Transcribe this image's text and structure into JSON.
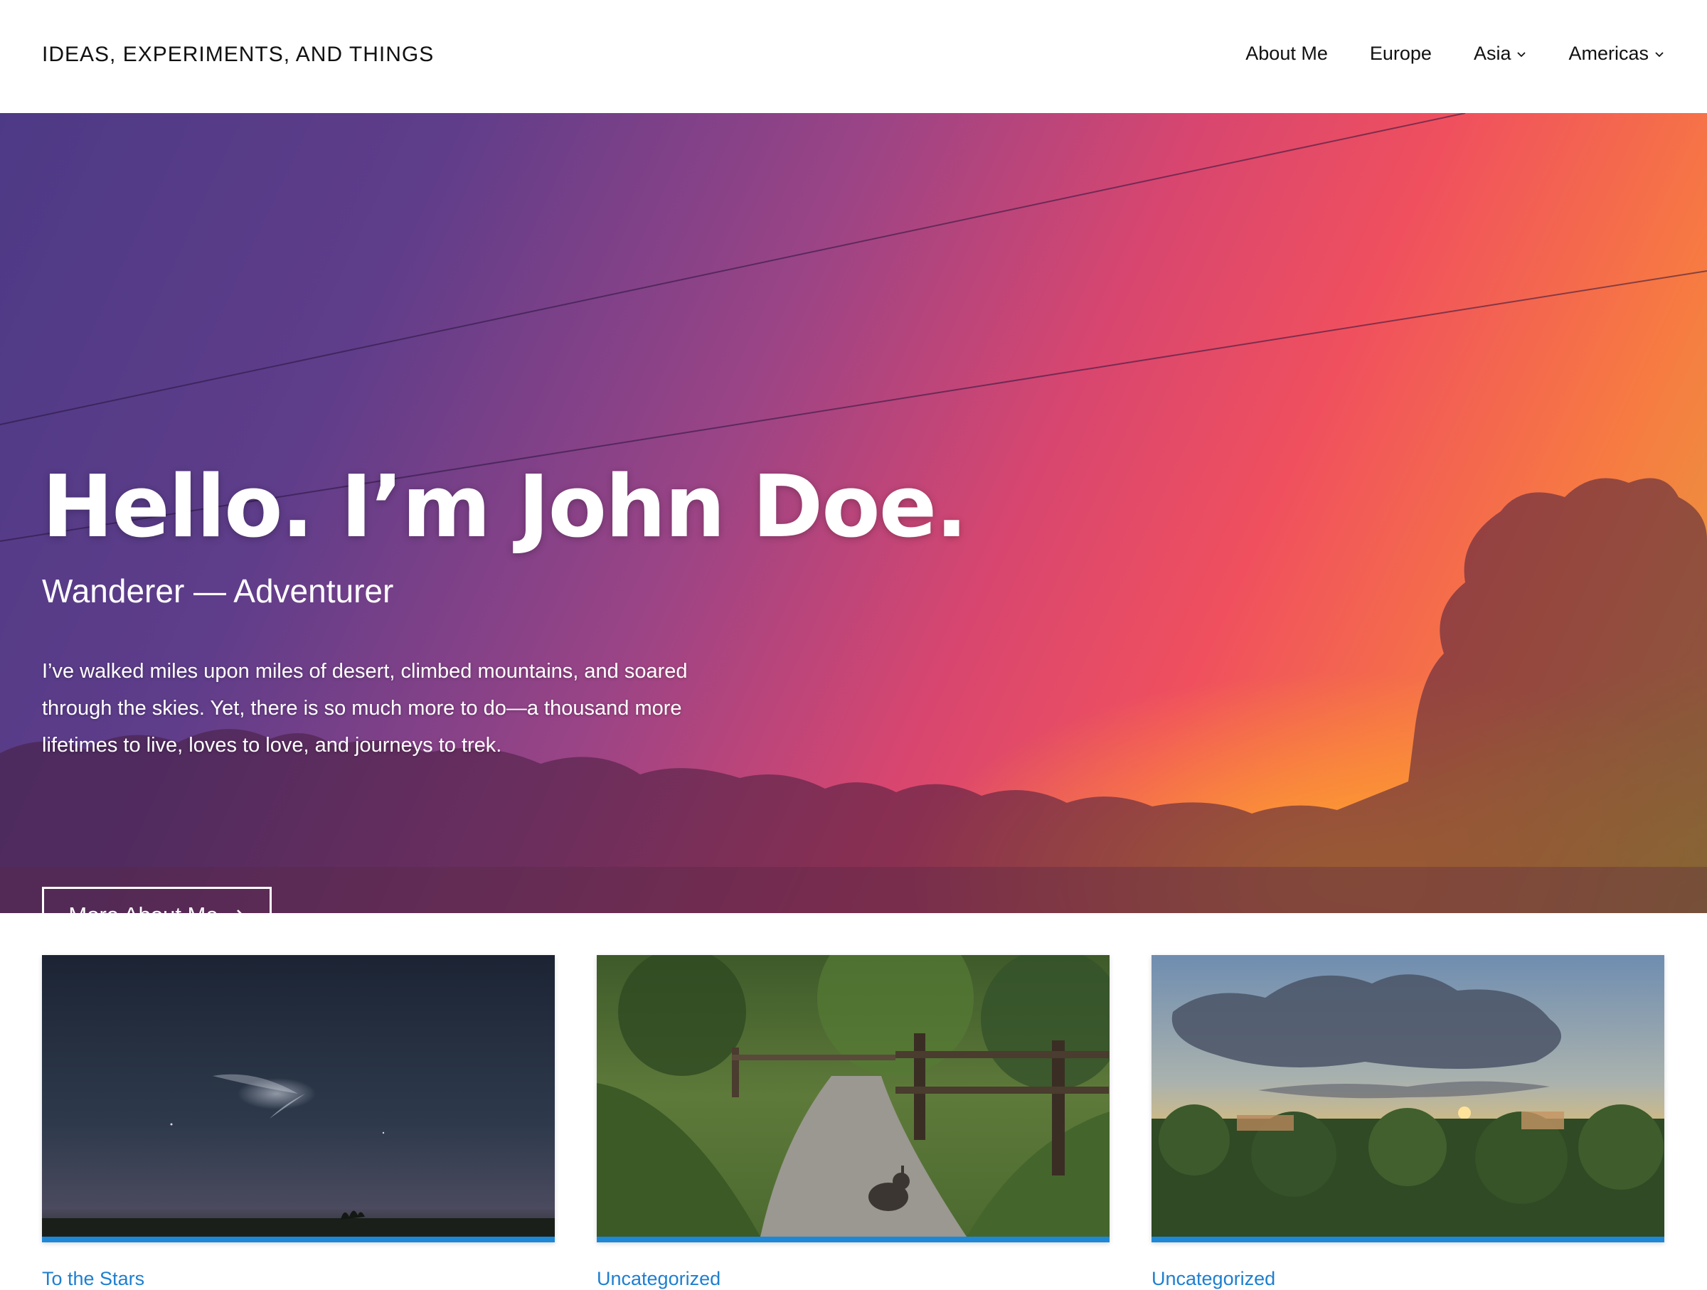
{
  "header": {
    "site_title": "IDEAS, EXPERIMENTS, AND THINGS",
    "nav": [
      {
        "label": "About Me",
        "has_dropdown": false
      },
      {
        "label": "Europe",
        "has_dropdown": false
      },
      {
        "label": "Asia",
        "has_dropdown": true
      },
      {
        "label": "Americas",
        "has_dropdown": true
      }
    ]
  },
  "hero": {
    "title": "Hello. I’m John Doe.",
    "subtitle": "Wanderer — Adventurer",
    "text": "I’ve walked miles upon miles of desert, climbed mountains, and soared through the skies. Yet, there is so much more to do—a thousand more lifetimes to live, loves to love, and journeys to trek.",
    "button_label": "More About Me",
    "button_icon": "arrow-right-icon"
  },
  "cards": [
    {
      "category": "To the Stars",
      "image": "night-sky-rocket-trail"
    },
    {
      "category": "Uncategorized",
      "image": "forest-path-rabbit"
    },
    {
      "category": "Uncategorized",
      "image": "sunset-palm-trees"
    }
  ],
  "colors": {
    "accent": "#1e88d6",
    "text": "#111111",
    "hero_text": "#ffffff"
  }
}
